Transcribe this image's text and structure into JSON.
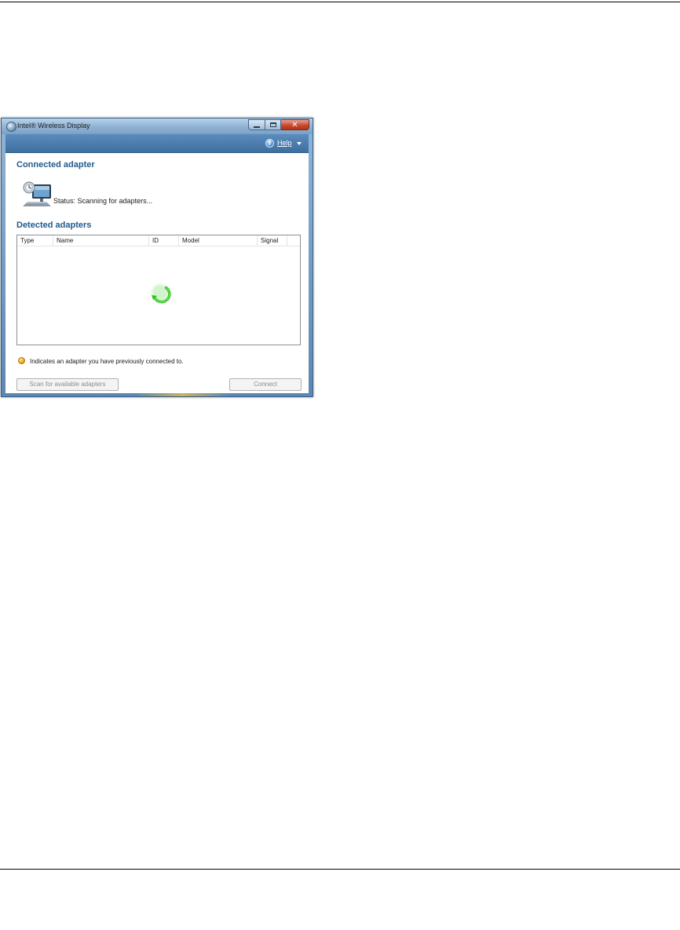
{
  "window": {
    "title": "Intel® Wireless Display",
    "controls": {
      "minimize": "minimize",
      "maximize": "maximize",
      "close": "✕"
    }
  },
  "toolbar": {
    "help_label": "Help",
    "help_icon": "?"
  },
  "connected": {
    "heading": "Connected adapter",
    "status": "Status: Scanning for adapters..."
  },
  "detected": {
    "heading": "Detected adapters",
    "columns": [
      "Type",
      "Name",
      "ID",
      "Model",
      "Signal"
    ]
  },
  "legend": {
    "text": "Indicates an adapter you have previously connected to."
  },
  "buttons": {
    "scan": "Scan for available adapters",
    "connect": "Connect"
  },
  "colors": {
    "heading": "#1f5a8c",
    "spinner": "#2fc21f",
    "legend_dot": "#f0a21a",
    "close": "#c6452b"
  }
}
